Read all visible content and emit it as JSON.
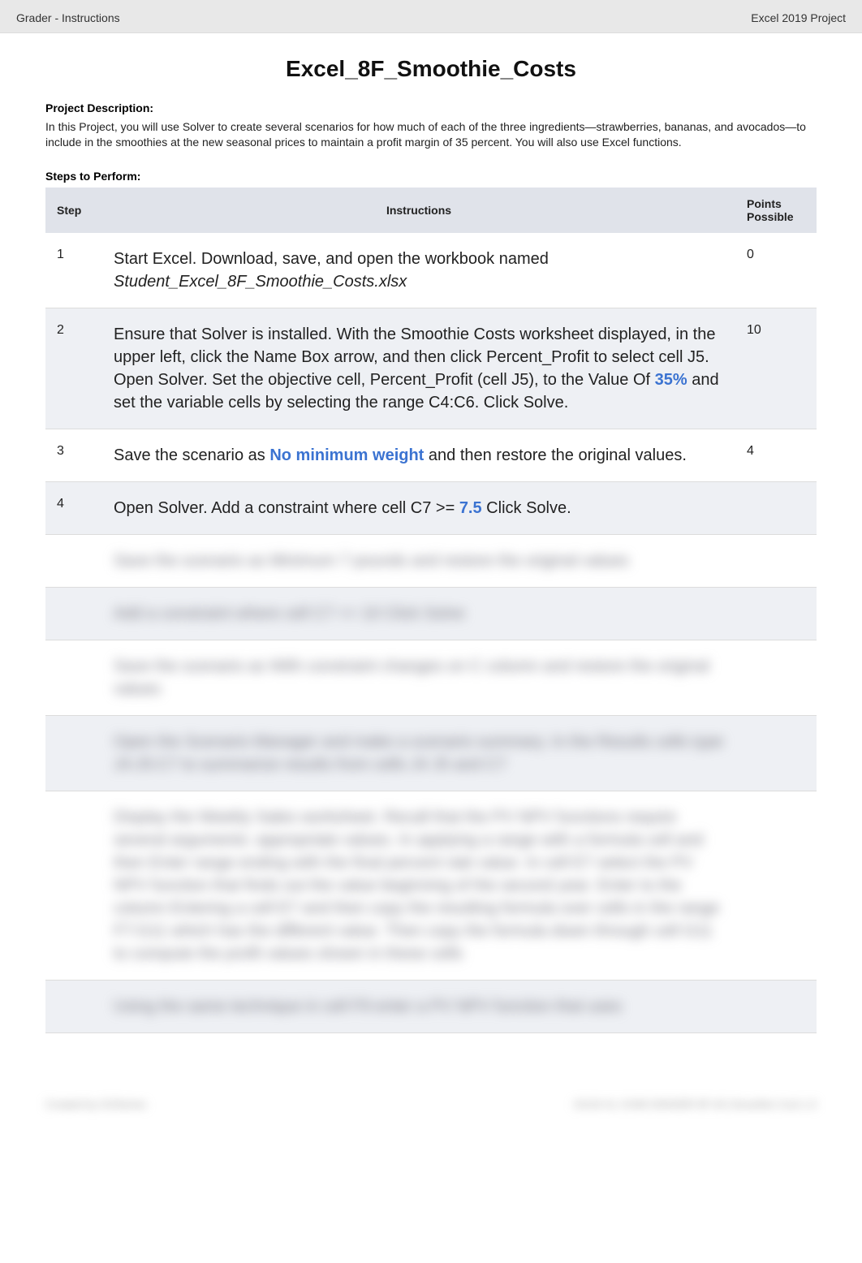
{
  "header": {
    "left": "Grader - Instructions",
    "right": "Excel 2019 Project"
  },
  "title": "Excel_8F_Smoothie_Costs",
  "project_desc_label": "Project Description:",
  "project_desc": "In this Project, you will use Solver to create several scenarios for how much of each of the three ingredients—strawberries, bananas, and avocados—to include in the smoothies at the new seasonal prices to maintain a profit margin of 35 percent. You will also use Excel functions.",
  "steps_label": "Steps to Perform:",
  "columns": {
    "step": "Step",
    "instructions": "Instructions",
    "points": "Points Possible"
  },
  "rows": [
    {
      "step": "1",
      "instr_pre": "Start Excel. Download, save, and open the workbook named ",
      "instr_italic": "Student_Excel_8F_Smoothie_Costs.xlsx",
      "points": "0",
      "alt": false
    },
    {
      "step": "2",
      "instr_pre": "Ensure that Solver is installed. With the Smoothie Costs worksheet displayed, in the upper left, click the Name Box arrow, and then click Percent_Profit to select cell J5. Open Solver. Set the objective cell, Percent_Profit (cell J5), to the Value Of ",
      "instr_blue": "35%",
      "instr_post": " and set the variable cells by selecting the range C4:C6. Click Solve.",
      "points": "10",
      "alt": true
    },
    {
      "step": "3",
      "instr_pre": "Save the scenario as ",
      "instr_blue": "No minimum weight",
      "instr_post": " and then restore the original values.",
      "points": "4",
      "alt": false
    },
    {
      "step": "4",
      "instr_pre": "Open Solver. Add a constraint where cell C7 >= ",
      "instr_blue": "7.5",
      "instr_post": " Click Solve.",
      "points": "",
      "alt": true
    }
  ],
  "blurred_rows": [
    {
      "step": "",
      "text": "Save the scenario as   Minimum 7 pounds   and restore the original values",
      "points": "",
      "alt": false
    },
    {
      "step": "",
      "text": "Add a constraint where cell C7 <= 10  Click Solve",
      "points": "",
      "alt": true
    },
    {
      "step": "",
      "text": "Save the scenario as   With constraint changes on C column   and restore the original values",
      "points": "",
      "alt": false
    },
    {
      "step": "",
      "text": "Open the Scenario Manager and make a scenario summary. In the Results cells type   J4:J5:C7   to summarize results from cells J4 J5 and C7",
      "points": "",
      "alt": true
    },
    {
      "step": "",
      "text": "Display the Weekly Sales worksheet. Recall that the PV NPV functions require several arguments: appropriate values. In applying a range with a formula cell and then Enter range ending with the final percent rate value. In cell E7 select the PV NPV function that finds out the value beginning of the second year. Enter to the column Entering a cell E7 and then copy the resulting formula over cells in the range F7:G11 which has the different value. Then copy the formula down through cell G11 to compute the profit values shown in these cells",
      "points": "",
      "alt": false
    },
    {
      "step": "",
      "text": "Using the same technique in cell F9 enter a PV NPV function that uses",
      "points": "",
      "alt": true
    }
  ],
  "footer": {
    "left": "Created by GOSeries",
    "right": "GO19 XL CH08 GRADER 8F AS Smoothie Cost 1.0"
  }
}
